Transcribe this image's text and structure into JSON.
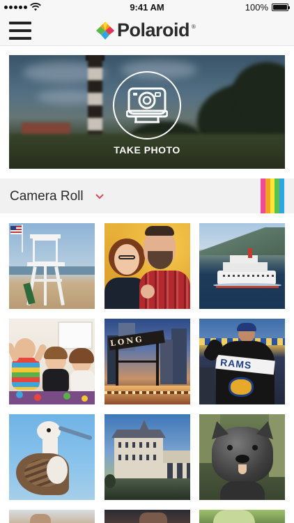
{
  "status_bar": {
    "carrier_signal": "signal-dots-icon",
    "wifi": "wifi-icon",
    "time": "9:41 AM",
    "battery_percent": "100%",
    "battery_level": 1.0
  },
  "nav": {
    "menu_icon": "hamburger-menu-icon",
    "logo_text": "Polaroid",
    "logo_tm": "®"
  },
  "hero": {
    "action_label": "TAKE PHOTO",
    "icon": "polaroid-camera-icon"
  },
  "camera_roll": {
    "title": "Camera Roll",
    "dropdown_icon": "chevron-down-icon",
    "rainbow_colors": [
      "#f24a9a",
      "#f2a31f",
      "#ffe63a",
      "#5ac04a",
      "#2ea6e6"
    ]
  },
  "photos": [
    {
      "subject": "lifeguard-tower-beach"
    },
    {
      "subject": "couple-portrait"
    },
    {
      "subject": "ferry-boat-on-lake"
    },
    {
      "subject": "kids-in-playroom"
    },
    {
      "subject": "long-island-sign-city"
    },
    {
      "subject": "rams-fan-jacket"
    },
    {
      "subject": "seabird-booby"
    },
    {
      "subject": "chateau-chenonceau"
    },
    {
      "subject": "dog-statue"
    }
  ],
  "colors": {
    "bar_bg": "#f7f7f7",
    "roll_bg": "#f1f1f1",
    "chevron": "#e0475b",
    "text": "#2a2a2a"
  }
}
